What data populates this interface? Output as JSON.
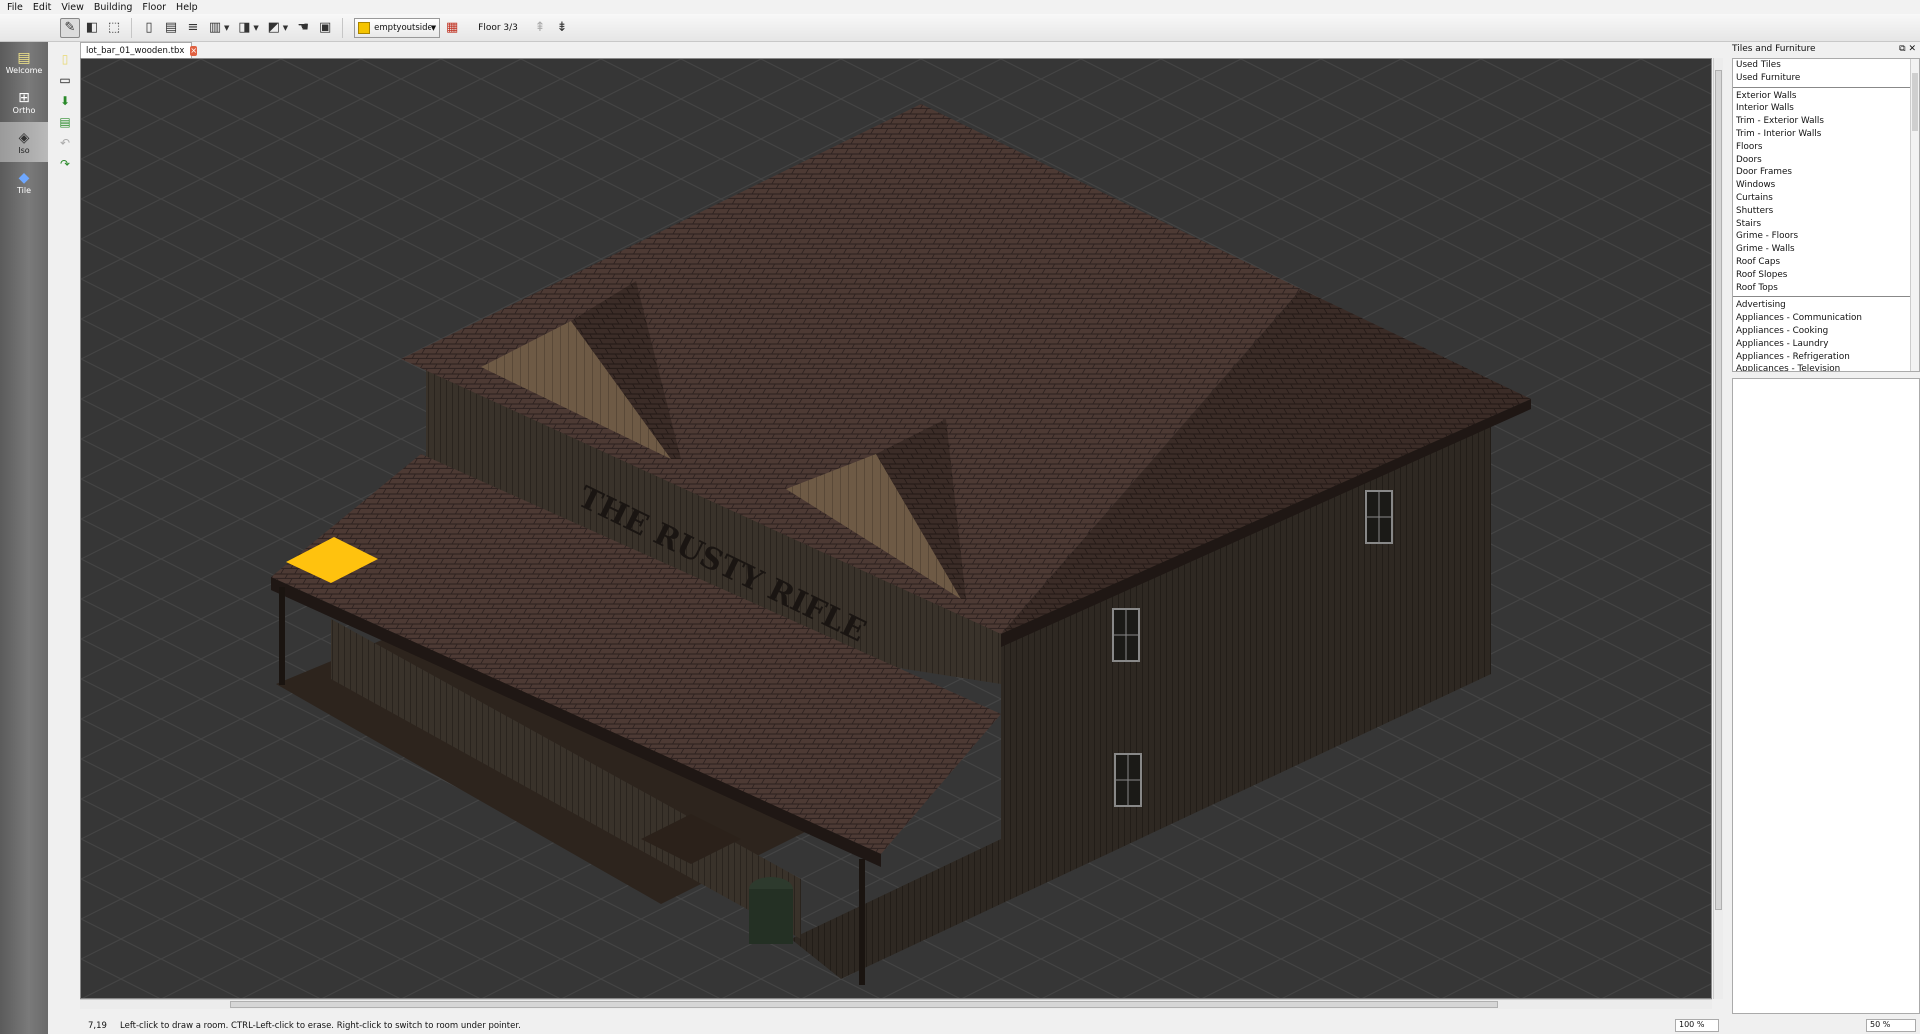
{
  "menu": [
    "File",
    "Edit",
    "View",
    "Building",
    "Floor",
    "Help"
  ],
  "toolbar": {
    "room_combo": "emptyoutside",
    "floor_label": "Floor 3/3",
    "room_color": "#f5c400"
  },
  "modes": [
    {
      "label": "Welcome",
      "icon": "welcome-icon"
    },
    {
      "label": "Ortho",
      "icon": "ortho-grid-icon"
    },
    {
      "label": "Iso",
      "icon": "iso-diamond-icon"
    },
    {
      "label": "Tile",
      "icon": "tile-icon"
    }
  ],
  "document_tab": "lot_bar_01_wooden.tbx",
  "canvas": {
    "sign_text": "THE RUSTY RIFLE"
  },
  "status": {
    "coords": "7,19",
    "message": "Left-click to draw a room.  CTRL-Left-click to erase.  Right-click to switch to room under pointer.",
    "zoom_canvas": "100 %",
    "zoom_tiles": "50 %"
  },
  "dock": {
    "title": "Tiles and Furniture",
    "group1": [
      "Used Tiles",
      "Used Furniture"
    ],
    "group2": [
      "Exterior Walls",
      "Interior Walls",
      "Trim - Exterior Walls",
      "Trim - Interior Walls",
      "Floors",
      "Doors",
      "Door Frames",
      "Windows",
      "Curtains",
      "Shutters",
      "Stairs",
      "Grime - Floors",
      "Grime - Walls",
      "Roof Caps",
      "Roof Slopes",
      "Roof Tops"
    ],
    "group3": [
      "Advertising",
      "Appliances - Communication",
      "Appliances - Cooking",
      "Appliances - Laundry",
      "Appliances - Refrigeration",
      "Applicances - Television"
    ]
  }
}
